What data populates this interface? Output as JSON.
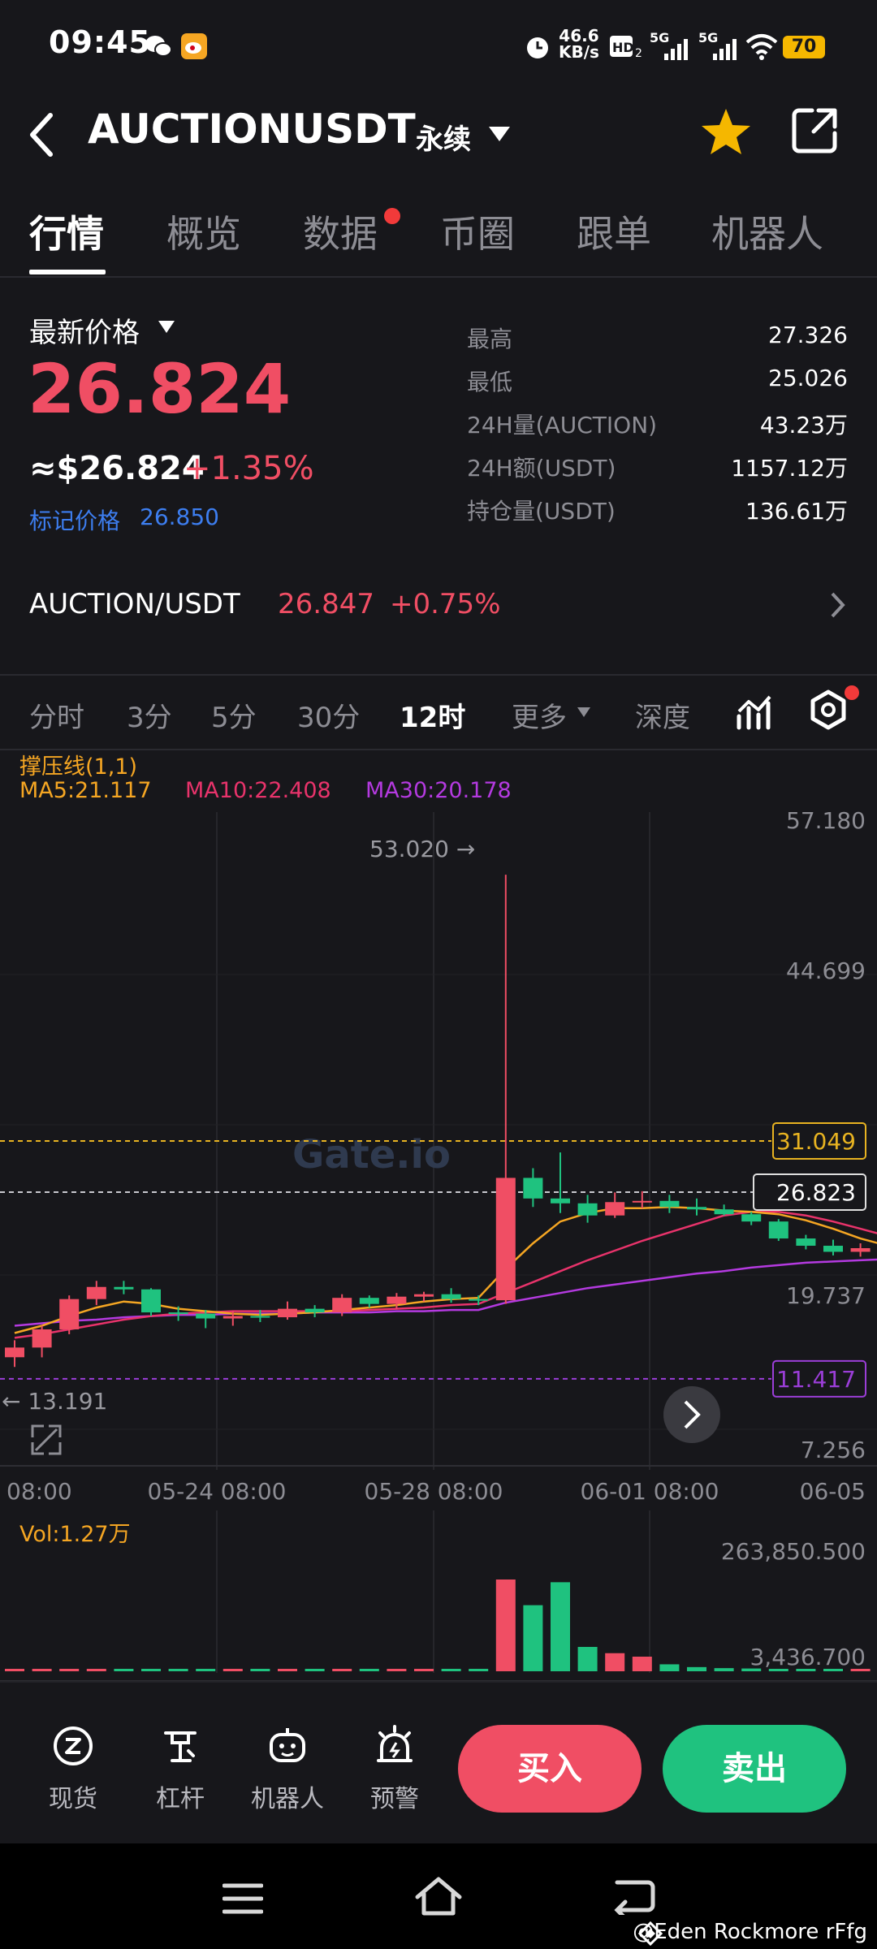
{
  "status_bar": {
    "time": "09:45",
    "network_speed": "46.6",
    "network_unit": "KB/s",
    "battery": "70"
  },
  "header": {
    "title": "AUCTIONUSDT",
    "contract_type": "永续"
  },
  "tabs": [
    {
      "label": "行情",
      "active": true
    },
    {
      "label": "概览",
      "active": false
    },
    {
      "label": "数据",
      "active": false,
      "has_dot": true
    },
    {
      "label": "币圈",
      "active": false
    },
    {
      "label": "跟单",
      "active": false
    },
    {
      "label": "机器人",
      "active": false
    }
  ],
  "price": {
    "label": "最新价格",
    "last": "26.824",
    "usd": "≈$26.824",
    "change": "+1.35%",
    "mark_label": "标记价格",
    "mark_value": "26.850"
  },
  "stats": [
    {
      "label": "最高",
      "value": "27.326"
    },
    {
      "label": "最低",
      "value": "25.026"
    },
    {
      "label": "24H量(AUCTION)",
      "value": "43.23万"
    },
    {
      "label": "24H额(USDT)",
      "value": "1157.12万"
    },
    {
      "label": "持仓量(USDT)",
      "value": "136.61万"
    }
  ],
  "spot_pair": {
    "name": "AUCTION/USDT",
    "price": "26.847",
    "change": "+0.75%"
  },
  "intervals": [
    {
      "label": "分时",
      "active": false
    },
    {
      "label": "3分",
      "active": false
    },
    {
      "label": "5分",
      "active": false
    },
    {
      "label": "30分",
      "active": false
    },
    {
      "label": "12时",
      "active": true
    },
    {
      "label": "更多",
      "active": false
    },
    {
      "label": "深度",
      "active": false
    }
  ],
  "indicators": {
    "sr_line": "撑压线(1,1)",
    "ma5": "MA5:21.117",
    "ma10": "MA10:22.408",
    "ma30": "MA30:20.178",
    "vol": "Vol:1.27万"
  },
  "colors": {
    "up": "#f04e64",
    "down": "#1fc27f",
    "ma5": "#f5a623",
    "ma10": "#e8336b",
    "ma30": "#b43ae0",
    "resistance": "#e8b321",
    "support": "#9b3ed8",
    "accent_blue": "#3d7ef0",
    "star": "#f5b700"
  },
  "chart_data": {
    "type": "candlestick",
    "price_ticks": [
      "57.180",
      "44.699",
      "31.049",
      "26.823",
      "19.737",
      "11.417",
      "7.256"
    ],
    "x_tick_labels": [
      "08:00",
      "05-24 08:00",
      "05-28 08:00",
      "06-01 08:00",
      "06-05"
    ],
    "high_label": "53.020 →",
    "low_label": "← 13.191",
    "resistance_price": 31.049,
    "support_price": 11.417,
    "current_price": 26.823,
    "ylim": [
      7.256,
      57.18
    ],
    "vol_ticks": [
      "263,850.500",
      "3,436.700"
    ],
    "candles": [
      {
        "o": 13.2,
        "h": 14.6,
        "l": 12.4,
        "c": 14.0
      },
      {
        "o": 14.0,
        "h": 15.8,
        "l": 13.191,
        "c": 15.5
      },
      {
        "o": 15.5,
        "h": 18.3,
        "l": 15.1,
        "c": 18.0
      },
      {
        "o": 18.0,
        "h": 19.5,
        "l": 17.5,
        "c": 19.0
      },
      {
        "o": 19.0,
        "h": 19.5,
        "l": 18.4,
        "c": 18.8
      },
      {
        "o": 18.8,
        "h": 18.9,
        "l": 16.6,
        "c": 16.9
      },
      {
        "o": 16.9,
        "h": 17.4,
        "l": 16.2,
        "c": 16.8
      },
      {
        "o": 16.8,
        "h": 17.1,
        "l": 15.6,
        "c": 16.4
      },
      {
        "o": 16.4,
        "h": 17.0,
        "l": 15.8,
        "c": 16.6
      },
      {
        "o": 16.6,
        "h": 17.1,
        "l": 16.1,
        "c": 16.5
      },
      {
        "o": 16.5,
        "h": 17.8,
        "l": 16.3,
        "c": 17.2
      },
      {
        "o": 17.2,
        "h": 17.5,
        "l": 16.5,
        "c": 16.9
      },
      {
        "o": 16.9,
        "h": 18.4,
        "l": 16.6,
        "c": 18.1
      },
      {
        "o": 18.1,
        "h": 18.3,
        "l": 17.3,
        "c": 17.6
      },
      {
        "o": 17.6,
        "h": 18.5,
        "l": 17.2,
        "c": 18.2
      },
      {
        "o": 18.2,
        "h": 18.6,
        "l": 17.8,
        "c": 18.4
      },
      {
        "o": 18.4,
        "h": 18.9,
        "l": 17.7,
        "c": 18.0
      },
      {
        "o": 18.0,
        "h": 18.3,
        "l": 17.5,
        "c": 17.9
      },
      {
        "o": 17.9,
        "h": 53.02,
        "l": 17.6,
        "c": 28.0
      },
      {
        "o": 28.0,
        "h": 28.8,
        "l": 25.6,
        "c": 26.3
      },
      {
        "o": 26.3,
        "h": 30.1,
        "l": 25.1,
        "c": 25.9
      },
      {
        "o": 25.9,
        "h": 26.6,
        "l": 24.3,
        "c": 24.9
      },
      {
        "o": 24.9,
        "h": 26.8,
        "l": 24.7,
        "c": 26.0
      },
      {
        "o": 26.0,
        "h": 26.9,
        "l": 25.5,
        "c": 26.1
      },
      {
        "o": 26.1,
        "h": 26.6,
        "l": 25.1,
        "c": 25.6
      },
      {
        "o": 25.6,
        "h": 26.3,
        "l": 24.9,
        "c": 25.4
      },
      {
        "o": 25.4,
        "h": 25.8,
        "l": 24.9,
        "c": 25.0
      },
      {
        "o": 25.0,
        "h": 25.2,
        "l": 24.1,
        "c": 24.4
      },
      {
        "o": 24.4,
        "h": 24.6,
        "l": 22.8,
        "c": 23.0
      },
      {
        "o": 23.0,
        "h": 23.3,
        "l": 22.1,
        "c": 22.4
      },
      {
        "o": 22.4,
        "h": 22.9,
        "l": 21.6,
        "c": 21.9
      },
      {
        "o": 21.9,
        "h": 22.6,
        "l": 21.5,
        "c": 22.2
      },
      {
        "o": 22.2,
        "h": 22.5,
        "l": 21.6,
        "c": 22.0
      }
    ],
    "volumes": [
      1200,
      4500,
      2800,
      1800,
      1600,
      800,
      600,
      500,
      700,
      650,
      900,
      800,
      1200,
      900,
      1000,
      950,
      800,
      700,
      263850,
      190000,
      256000,
      70000,
      52000,
      42000,
      20000,
      12000,
      9000,
      8000,
      6000,
      5000,
      4500,
      3500,
      3000
    ],
    "ma5": [
      15.2,
      15.8,
      16.6,
      17.3,
      17.8,
      17.6,
      17.2,
      17.0,
      16.8,
      16.7,
      16.8,
      16.9,
      17.1,
      17.3,
      17.5,
      17.8,
      18.0,
      18.1,
      20.5,
      22.6,
      24.4,
      25.1,
      25.5,
      25.5,
      25.6,
      25.5,
      25.3,
      25.2,
      25.0,
      24.5,
      23.8,
      23.0,
      22.4
    ],
    "ma10": [
      14.8,
      15.1,
      15.5,
      15.9,
      16.3,
      16.6,
      16.8,
      16.9,
      17.0,
      17.0,
      17.0,
      17.0,
      17.0,
      17.1,
      17.2,
      17.3,
      17.5,
      17.6,
      18.5,
      19.4,
      20.3,
      21.2,
      22.0,
      22.8,
      23.5,
      24.2,
      24.9,
      25.2,
      25.2,
      24.9,
      24.4,
      23.8,
      23.2
    ],
    "ma30": [
      15.8,
      16.0,
      16.2,
      16.3,
      16.5,
      16.6,
      16.7,
      16.7,
      16.8,
      16.8,
      16.8,
      16.9,
      16.9,
      16.9,
      17.0,
      17.0,
      17.1,
      17.1,
      17.7,
      18.1,
      18.5,
      18.9,
      19.2,
      19.5,
      19.8,
      20.1,
      20.3,
      20.6,
      20.8,
      21.0,
      21.1,
      21.2,
      21.3
    ]
  },
  "bottom_bar": {
    "items": [
      {
        "label": "现货",
        "icon": "spot-icon"
      },
      {
        "label": "杠杆",
        "icon": "leverage-icon"
      },
      {
        "label": "机器人",
        "icon": "robot-icon"
      },
      {
        "label": "预警",
        "icon": "alert-icon"
      }
    ],
    "buy": "买入",
    "sell": "卖出"
  },
  "watermark": "@Eden Rockmore rFfg"
}
